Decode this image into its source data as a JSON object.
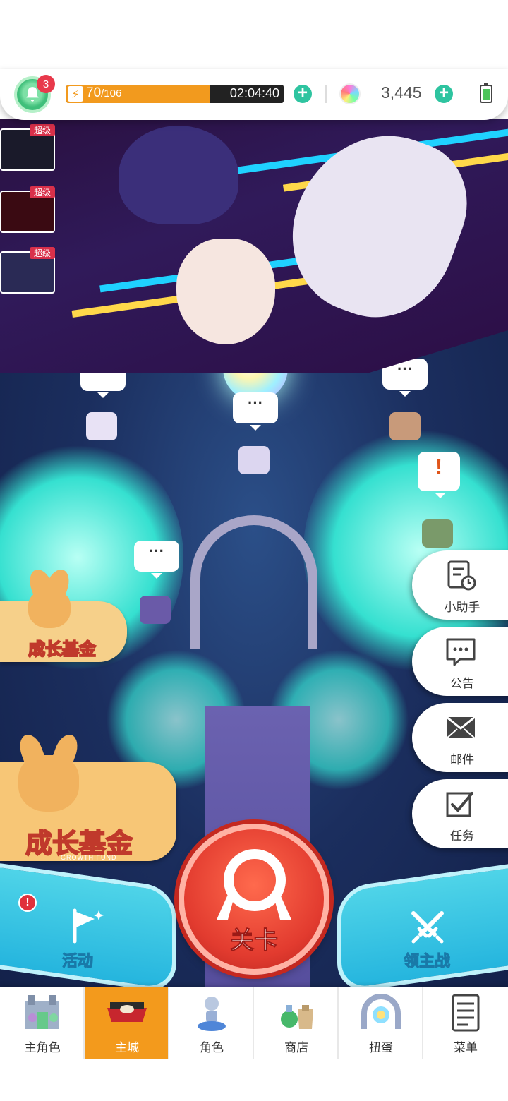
{
  "status": {
    "notification_count": "3",
    "stamina_current": "70",
    "stamina_max": "/106",
    "stamina_fraction": 0.66,
    "regen_timer": "02:04:40",
    "gems": "3,445"
  },
  "events": {
    "thumb_tags": [
      "超级",
      "超级",
      "超级"
    ]
  },
  "fund": {
    "title": "成长基金",
    "subtitle": "GROWTH FUND"
  },
  "side_menu": {
    "assistant": "小助手",
    "announcement": "公告",
    "mail": "邮件",
    "tasks": "任务"
  },
  "actions": {
    "activity": "活动",
    "activity_alert": "!",
    "stage": "关卡",
    "lord_battle": "领主战"
  },
  "bubbles": {
    "dots": "···",
    "alert": "!"
  },
  "nav": {
    "items": [
      "主角色",
      "主城",
      "角色",
      "商店",
      "扭蛋",
      "菜单"
    ],
    "active_index": 1
  },
  "colors": {
    "accent_orange": "#f39a1c",
    "stage_red": "#e23b2f",
    "action_cyan": "#25b5de",
    "plus_green": "#2ec4a0"
  }
}
